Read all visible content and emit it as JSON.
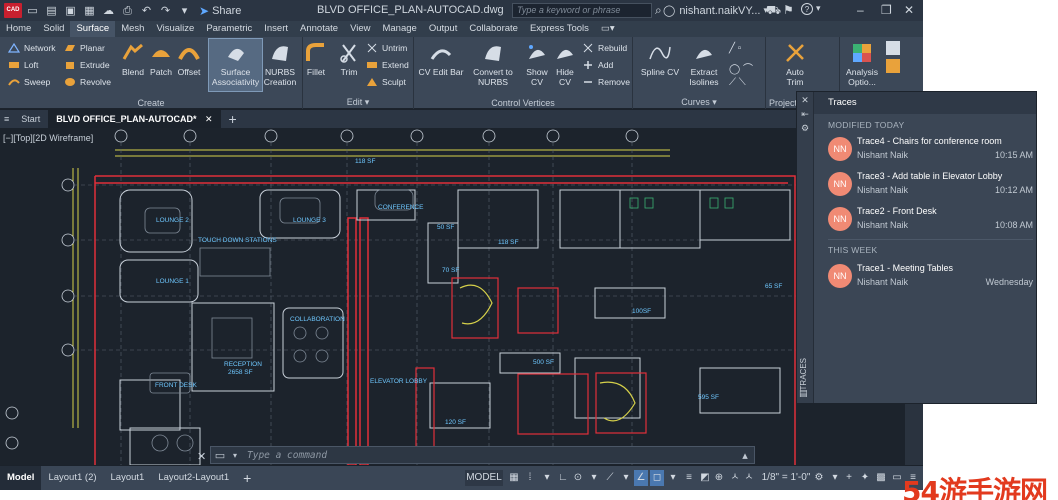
{
  "titlebar": {
    "app_logo": "CAD",
    "share": "Share",
    "doc_title": "BLVD OFFICE_PLAN-AUTOCAD.dwg",
    "search_placeholder": "Type a keyword or phrase",
    "user": "nishant.naikVY..."
  },
  "tabs": [
    "Home",
    "Solid",
    "Surface",
    "Mesh",
    "Visualize",
    "Parametric",
    "Insert",
    "Annotate",
    "View",
    "Manage",
    "Output",
    "Collaborate",
    "Express Tools"
  ],
  "active_tab": "Surface",
  "ribbon": {
    "create": {
      "title": "Create",
      "network": "Network",
      "loft": "Loft",
      "sweep": "Sweep",
      "planar": "Planar",
      "extrude": "Extrude",
      "revolve": "Revolve",
      "blend": "Blend",
      "patch": "Patch",
      "offset": "Offset",
      "surface_associativity_1": "Surface",
      "surface_associativity_2": "Associativity",
      "nurbs_1": "NURBS",
      "nurbs_2": "Creation"
    },
    "edit": {
      "title": "Edit",
      "fillet": "Fillet",
      "trim": "Trim",
      "untrim": "Untrim",
      "extend": "Extend",
      "sculpt": "Sculpt"
    },
    "control_vertices": {
      "title": "Control Vertices",
      "cv_edit_bar": "CV Edit Bar",
      "convert_1": "Convert to",
      "convert_2": "NURBS",
      "show_1": "Show",
      "show_2": "CV",
      "hide_1": "Hide",
      "hide_2": "CV",
      "rebuild": "Rebuild",
      "add": "Add",
      "remove": "Remove"
    },
    "curves": {
      "title": "Curves",
      "spline_1": "Spline CV",
      "extract_1": "Extract",
      "extract_2": "Isolines"
    },
    "project": {
      "title": "Project",
      "auto_1": "Auto",
      "auto_2": "Trim"
    },
    "analysis": {
      "title": "Analysis",
      "label_1": "Analysis",
      "label_2": "Optio..."
    }
  },
  "doc_tabs": [
    "Start",
    "BLVD OFFICE_PLAN-AUTOCAD*"
  ],
  "view_label": "[−][Top][2D Wireframe]",
  "drawing_labels": {
    "lounge2": "LOUNGE 2",
    "lounge3": "LOUNGE 3",
    "conference": "CONFERENCE",
    "touchdown": "TOUCH DOWN STATIONS",
    "lounge1": "LOUNGE 1",
    "collaboration": "COLLABORATION",
    "reception": "RECEPTION",
    "reception_sf": "2658 SF",
    "front_desk": "FRONT DESK",
    "elevator_lobby": "ELEVATOR LOBBY",
    "sf118a": "118 SF",
    "sf118b": "118 SF",
    "sf50": "50 SF",
    "sf70": "70 SF",
    "sf100": "100SF",
    "sf500": "500 SF",
    "sf595": "595 SF",
    "sf120": "120 SF",
    "sf65": "65 SF"
  },
  "command_placeholder": "Type a command",
  "layout_tabs": [
    "Model",
    "Layout1 (2)",
    "Layout1",
    "Layout2-Layout1"
  ],
  "status": {
    "model": "MODEL",
    "scale": "1/8\" = 1'-0\""
  },
  "traces": {
    "header": "Traces",
    "vertical_label": "TRACES",
    "section_today": "MODIFIED TODAY",
    "section_week": "THIS WEEK",
    "items": [
      {
        "avatar": "NN",
        "title": "Trace4 - Chairs for conference room",
        "author": "Nishant Naik",
        "time": "10:15 AM"
      },
      {
        "avatar": "NN",
        "title": "Trace3 - Add table in Elevator Lobby",
        "author": "Nishant Naik",
        "time": "10:12 AM"
      },
      {
        "avatar": "NN",
        "title": "Trace2 - Front Desk",
        "author": "Nishant Naik",
        "time": "10:08 AM"
      },
      {
        "avatar": "NN",
        "title": "Trace1 - Meeting Tables",
        "author": "Nishant Naik",
        "time": "Wednesday"
      }
    ]
  },
  "watermark": "54游手游网",
  "colors": {
    "accent_red": "#c8202f",
    "drawing_bg": "#1c232c",
    "wall_red": "#e0303a",
    "dim_yellow": "#d6d14a",
    "avatar": "#f08a74"
  }
}
